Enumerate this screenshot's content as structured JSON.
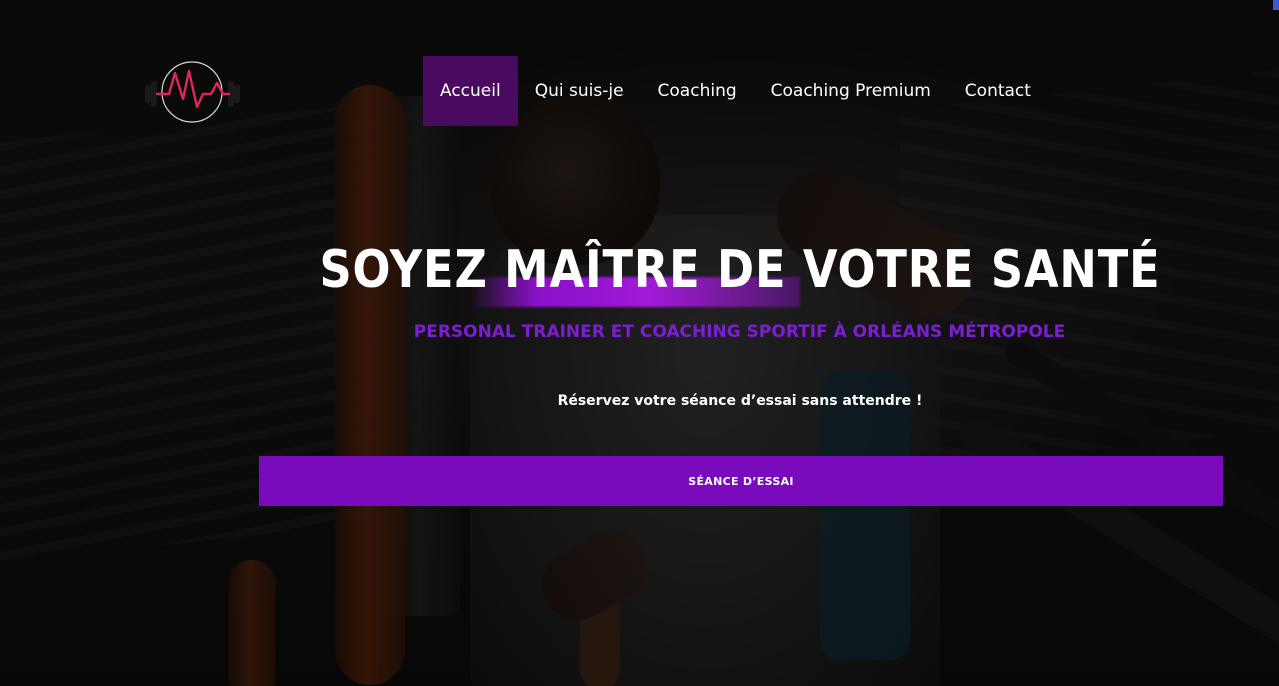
{
  "nav": {
    "items": [
      {
        "label": "Accueil",
        "active": true
      },
      {
        "label": "Qui suis-je",
        "active": false
      },
      {
        "label": "Coaching",
        "active": false
      },
      {
        "label": "Coaching Premium",
        "active": false
      },
      {
        "label": "Contact",
        "active": false
      }
    ]
  },
  "logo": {
    "icon": "heartbeat-dumbbell-logo",
    "letters": "MV"
  },
  "hero": {
    "headline": "SOYEZ MAÎTRE DE VOTRE SANTÉ",
    "subtitle": "PERSONAL TRAINER ET COACHING SPORTIF À ORLÉANS MÉTROPOLE",
    "cta_text": "Réservez votre séance d’essai sans attendre !",
    "button_label": "SÉANCE D’ESSAI"
  },
  "colors": {
    "accent": "#7a0bbd",
    "nav_active_bg": "#4a0a5f",
    "subtitle": "#7b1fd0",
    "logo_line": "#e0245e"
  }
}
